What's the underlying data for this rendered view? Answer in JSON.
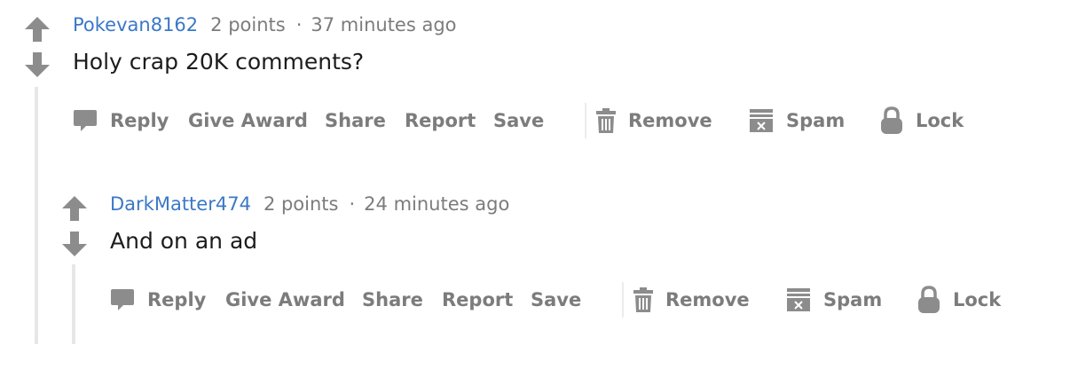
{
  "comments": [
    {
      "author": "Pokevan8162",
      "points": "2 points",
      "separator": "·",
      "time": "37 minutes ago",
      "body": "Holy crap 20K comments?",
      "actions": {
        "reply": "Reply",
        "give_award": "Give Award",
        "share": "Share",
        "report": "Report",
        "save": "Save",
        "remove": "Remove",
        "spam": "Spam",
        "lock": "Lock"
      }
    },
    {
      "author": "DarkMatter474",
      "points": "2 points",
      "separator": "·",
      "time": "24 minutes ago",
      "body": "And on an ad",
      "actions": {
        "reply": "Reply",
        "give_award": "Give Award",
        "share": "Share",
        "report": "Report",
        "save": "Save",
        "remove": "Remove",
        "spam": "Spam",
        "lock": "Lock"
      }
    }
  ],
  "icons": {
    "upvote": "upvote-arrow-icon",
    "downvote": "downvote-arrow-icon",
    "reply": "comment-bubble-icon",
    "remove": "trash-icon",
    "spam": "spam-box-icon",
    "lock": "lock-icon"
  },
  "colors": {
    "author": "#3a78c7",
    "meta": "#7c7c7c",
    "body": "#1c1c1c",
    "icon": "#8c8c8c",
    "thread_line": "#e7e7e7"
  }
}
